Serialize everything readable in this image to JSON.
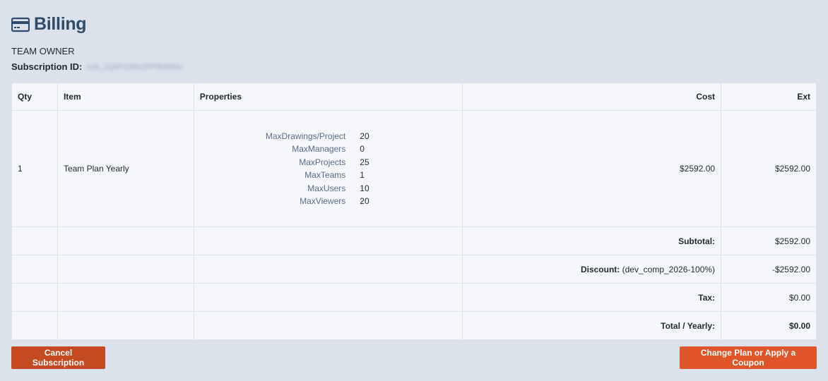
{
  "header": {
    "title": "Billing",
    "icon": "credit-card-icon"
  },
  "owner": {
    "role": "TEAM OWNER",
    "subscription_label": "Subscription ID:",
    "subscription_id": "sub_1QaF43bKcRP8hbNdu"
  },
  "table": {
    "headers": {
      "qty": "Qty",
      "item": "Item",
      "properties": "Properties",
      "cost": "Cost",
      "ext": "Ext"
    },
    "row": {
      "qty": "1",
      "item": "Team Plan Yearly",
      "properties": [
        {
          "name": "MaxDrawings/Project",
          "value": "20"
        },
        {
          "name": "MaxManagers",
          "value": "0"
        },
        {
          "name": "MaxProjects",
          "value": "25"
        },
        {
          "name": "MaxTeams",
          "value": "1"
        },
        {
          "name": "MaxUsers",
          "value": "10"
        },
        {
          "name": "MaxViewers",
          "value": "20"
        }
      ],
      "cost": "$2592.00",
      "ext": "$2592.00"
    },
    "summary": {
      "subtotal_label": "Subtotal:",
      "subtotal_value": "$2592.00",
      "discount_label": "Discount:",
      "discount_code": "(dev_comp_2026-100%)",
      "discount_value": "-$2592.00",
      "tax_label": "Tax:",
      "tax_value": "$0.00",
      "total_label": "Total / Yearly:",
      "total_value": "$0.00"
    }
  },
  "actions": {
    "cancel_label": "Cancel Subscription",
    "change_label": "Change Plan or Apply a Coupon"
  },
  "colors": {
    "background": "#dbe2ec",
    "title": "#2f4a6a",
    "cancel_button": "#c54921",
    "change_button": "#e0552a"
  }
}
